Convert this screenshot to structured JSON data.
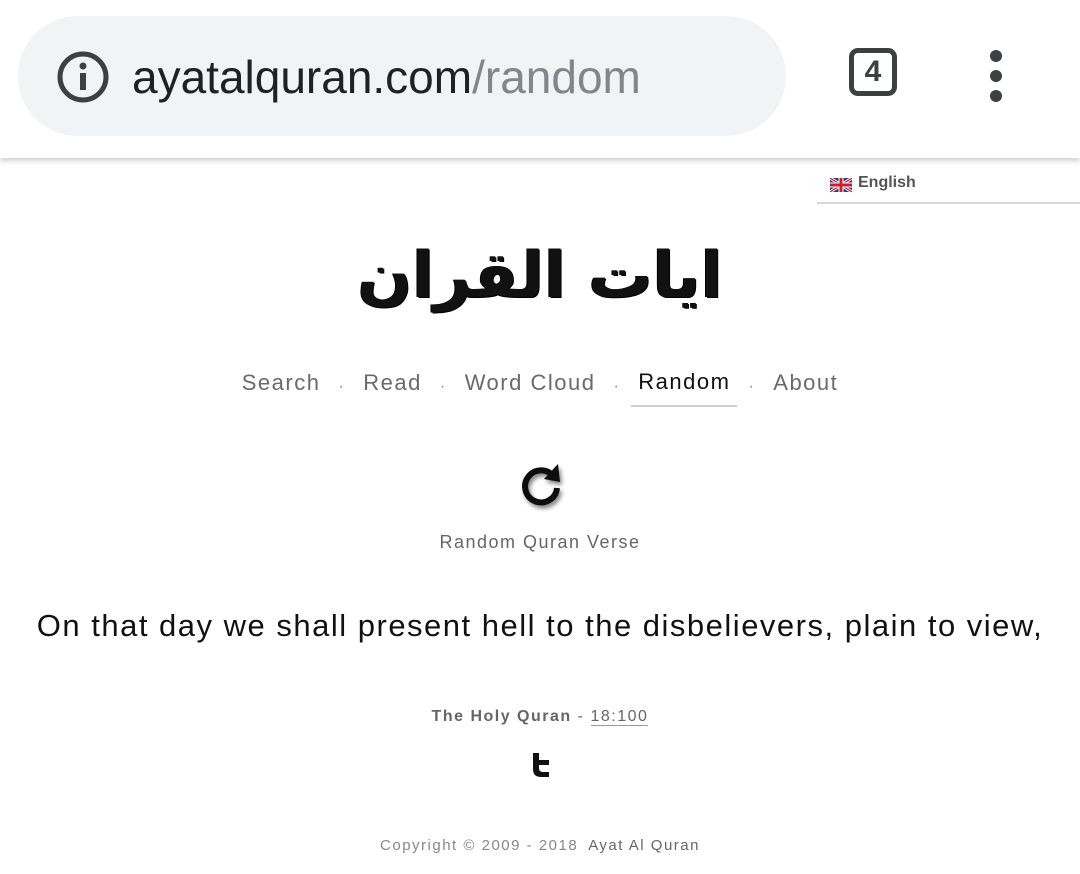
{
  "browser": {
    "url_host": "ayatalquran.com",
    "url_path": "/random",
    "tab_count": "4",
    "icons": {
      "info": "info-icon",
      "menu": "more-vert-icon"
    }
  },
  "language": {
    "label": "English",
    "flag_icon": "uk-flag-icon"
  },
  "logo": {
    "text": "ايات القران"
  },
  "nav": {
    "items": [
      {
        "label": "Search"
      },
      {
        "label": "Read"
      },
      {
        "label": "Word Cloud"
      },
      {
        "label": "Random",
        "active": true
      },
      {
        "label": "About"
      }
    ],
    "separator": "·"
  },
  "random": {
    "label": "Random Quran Verse",
    "icon": "refresh-icon"
  },
  "verse": {
    "text": "On that day we shall present hell to the disbelievers, plain to view,"
  },
  "source": {
    "book": "The Holy Quran",
    "dash": "-",
    "reference": "18:100"
  },
  "share": {
    "icon": "twitter-icon"
  },
  "footer": {
    "copyright": "Copyright © 2009 - 2018",
    "site": "Ayat Al Quran"
  }
}
